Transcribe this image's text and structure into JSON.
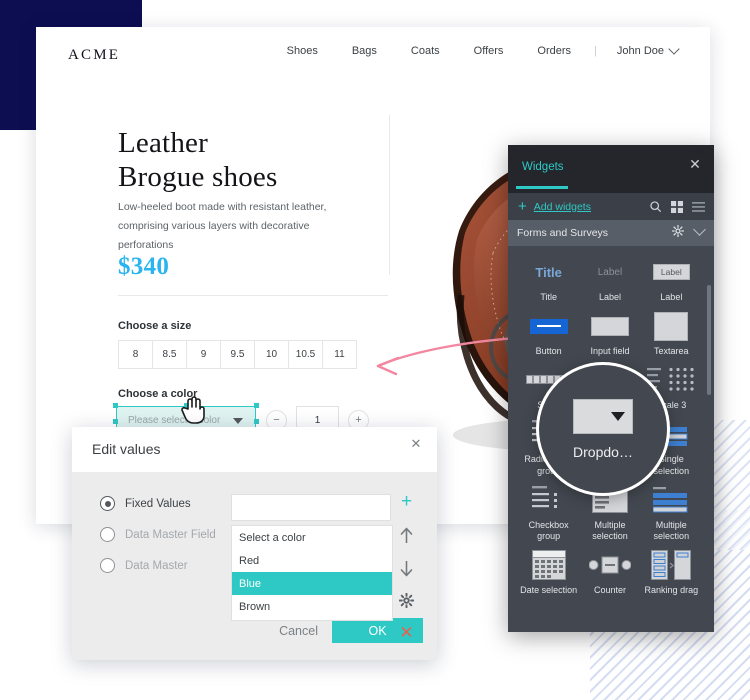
{
  "site": {
    "brand": "ACME",
    "nav": [
      {
        "label": "Shoes"
      },
      {
        "label": "Bags"
      },
      {
        "label": "Coats"
      },
      {
        "label": "Offers"
      },
      {
        "label": "Orders"
      }
    ],
    "separator": "|",
    "user": "John Doe"
  },
  "product": {
    "title_line1": "Leather",
    "title_line2": "Brogue shoes",
    "description": "Low-heeled boot made with resistant leather, comprising various layers with decorative perforations",
    "price": "$340",
    "price_color": "#2ab4f0",
    "size_label": "Choose a size",
    "sizes": [
      "8",
      "8.5",
      "9",
      "9.5",
      "10",
      "10.5",
      "11"
    ],
    "color_label": "Choose a color",
    "color_placeholder": "Please select a color",
    "quantity": "1",
    "qty_minus": "−",
    "qty_plus": "+",
    "image_alt": "brown-leather-brogue-shoe"
  },
  "panel": {
    "tab": "Widgets",
    "close": "✕",
    "add_plus": "+",
    "add_label": "Add widgets",
    "toolbar_icons": [
      "search-icon",
      "grid-view-icon",
      "list-view-icon"
    ],
    "section": "Forms and Surveys",
    "section_icons": [
      "gear-icon",
      "chevron-down-icon"
    ],
    "accent": "#2ec9c4",
    "widgets": [
      {
        "label": "Title",
        "icon": "title-icon"
      },
      {
        "label": "Label",
        "icon": "label-icon"
      },
      {
        "label": "Label",
        "icon": "label-boxed-icon"
      },
      {
        "label": "Button",
        "icon": "button-icon"
      },
      {
        "label": "Input field",
        "icon": "input-field-icon"
      },
      {
        "label": "Textarea",
        "icon": "textarea-icon"
      },
      {
        "label": "Scale",
        "icon": "scale-icon"
      },
      {
        "label": "Dropdown",
        "icon": "dropdown-icon"
      },
      {
        "label": "Scale 3",
        "icon": "scale3-icon"
      },
      {
        "label": "Radiobutton group",
        "icon": "radiobutton-group-icon"
      },
      {
        "label": "Dropdown",
        "icon": "dropdown-icon"
      },
      {
        "label": "Single selection",
        "icon": "single-selection-icon"
      },
      {
        "label": "Checkbox group",
        "icon": "checkbox-group-icon"
      },
      {
        "label": "Multiple selection",
        "icon": "multiple-selection-icon"
      },
      {
        "label": "Multiple selection",
        "icon": "multiple-selection-bars-icon"
      },
      {
        "label": "Date selection",
        "icon": "date-selection-icon"
      },
      {
        "label": "Counter",
        "icon": "counter-icon"
      },
      {
        "label": "Ranking drag",
        "icon": "ranking-drag-icon"
      }
    ]
  },
  "magnifier": {
    "label": "Dropdo…"
  },
  "dialog": {
    "title": "Edit values",
    "close": "✕",
    "options": [
      {
        "label": "Fixed Values",
        "selected": true
      },
      {
        "label": "Data Master Field",
        "selected": false
      },
      {
        "label": "Data Master",
        "selected": false
      }
    ],
    "new_value": "",
    "values": [
      {
        "label": "Select a color",
        "selected": false
      },
      {
        "label": "Red",
        "selected": false
      },
      {
        "label": "Blue",
        "selected": true
      },
      {
        "label": "Brown",
        "selected": false
      }
    ],
    "side_icons": [
      "add-icon",
      "move-up-icon",
      "move-down-icon",
      "settings-icon",
      "delete-icon"
    ],
    "add": "+",
    "up": "↑",
    "down": "↓",
    "delete": "✕",
    "cancel": "Cancel",
    "ok": "OK",
    "accent": "#2ec9c4"
  }
}
